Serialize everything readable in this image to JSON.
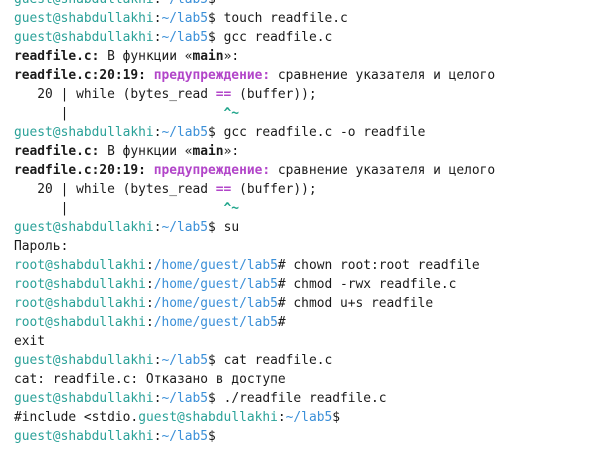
{
  "prompt": {
    "guest_user": "guest@shabdullakhi",
    "guest_path": "~/lab5",
    "guest_symbol": "$",
    "root_user": "root@shabdullakhi",
    "root_path": "/home/guest/lab5",
    "root_symbol": "#",
    "colon": ":"
  },
  "lines": [
    {
      "type": "prompt",
      "who": "guest",
      "cmd": ""
    },
    {
      "type": "prompt",
      "who": "guest",
      "cmd": " touch readfile.c"
    },
    {
      "type": "prompt",
      "who": "guest",
      "cmd": " gcc readfile.c"
    },
    {
      "type": "infunc",
      "file": "readfile.c:",
      "text": " В функции «",
      "func": "main",
      "end": "»:"
    },
    {
      "type": "warning",
      "loc": "readfile.c:20:19:",
      "label": " предупреждение:",
      "msg": " сравнение указателя и целого"
    },
    {
      "type": "code",
      "pre": "   20 | while (bytes_read ",
      "op": "==",
      "post": " (buffer));"
    },
    {
      "type": "caret",
      "pre": "      |                    ",
      "mark": "^~"
    },
    {
      "type": "prompt",
      "who": "guest",
      "cmd": " gcc readfile.c -o readfile"
    },
    {
      "type": "infunc",
      "file": "readfile.c:",
      "text": " В функции «",
      "func": "main",
      "end": "»:"
    },
    {
      "type": "warning",
      "loc": "readfile.c:20:19:",
      "label": " предупреждение:",
      "msg": " сравнение указателя и целого"
    },
    {
      "type": "code",
      "pre": "   20 | while (bytes_read ",
      "op": "==",
      "post": " (buffer));"
    },
    {
      "type": "caret",
      "pre": "      |                    ",
      "mark": "^~"
    },
    {
      "type": "prompt",
      "who": "guest",
      "cmd": " su"
    },
    {
      "type": "plain",
      "text": "Пароль:"
    },
    {
      "type": "prompt",
      "who": "root",
      "cmd": " chown root:root readfile"
    },
    {
      "type": "prompt",
      "who": "root",
      "cmd": " chmod -rwx readfile.c"
    },
    {
      "type": "prompt",
      "who": "root",
      "cmd": " chmod u+s readfile"
    },
    {
      "type": "prompt",
      "who": "root",
      "cmd": ""
    },
    {
      "type": "plain",
      "text": "exit"
    },
    {
      "type": "prompt",
      "who": "guest",
      "cmd": " cat readfile.c"
    },
    {
      "type": "plain",
      "text": "cat: readfile.c: Отказано в доступе"
    },
    {
      "type": "prompt",
      "who": "guest",
      "cmd": " ./readfile readfile.c"
    },
    {
      "type": "include",
      "text": "#include <stdio.",
      "who": "guest"
    },
    {
      "type": "prompt",
      "who": "guest",
      "cmd": ""
    }
  ]
}
